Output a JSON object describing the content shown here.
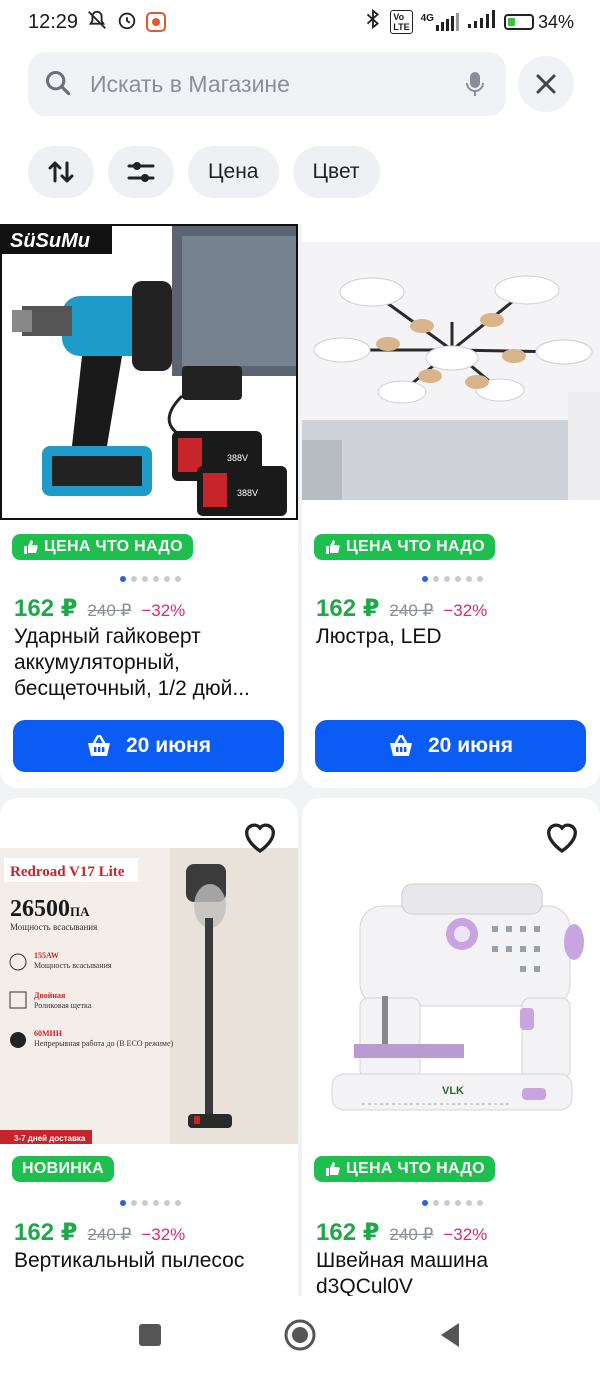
{
  "status": {
    "time": "12:29",
    "network": "4G",
    "battery": "34%",
    "battery_level_fraction": 0.34
  },
  "search": {
    "placeholder": "Искать в Магазине"
  },
  "filters": {
    "price_label": "Цена",
    "color_label": "Цвет"
  },
  "products": [
    {
      "badge": "ЦЕНА ЧТО НАДО",
      "price": "162 ₽",
      "old_price": "240 ₽",
      "discount": "−32%",
      "title": "Ударный гайковерт аккумуляторный, бесщеточный, 1/2 дюй...",
      "delivery": "20 июня",
      "image_brand": "SüSuMu",
      "battery_label": "388V"
    },
    {
      "badge": "ЦЕНА ЧТО НАДО",
      "price": "162 ₽",
      "old_price": "240 ₽",
      "discount": "−32%",
      "title": "Люстра, LED",
      "delivery": "20 июня"
    },
    {
      "badge": "НОВИНКА",
      "price": "162 ₽",
      "old_price": "240 ₽",
      "discount": "−32%",
      "title": "Вертикальный пылесос",
      "image_heading": "Redroad V17 Lite",
      "image_power": "26500",
      "image_power_unit": "ПА",
      "image_power_caption": "Мощность всасывания",
      "image_features": [
        {
          "title": "155AW",
          "text": "Мощность всасывания"
        },
        {
          "title": "Двойная",
          "text": "Роликовая щетка"
        },
        {
          "title": "60МИН",
          "text": "Непрерывная работа до (В ECO режиме)"
        }
      ],
      "image_delivery": "3-7 дней доставка"
    },
    {
      "badge": "ЦЕНА ЧТО НАДО",
      "price": "162 ₽",
      "old_price": "240 ₽",
      "discount": "−32%",
      "title": "Швейная машина d3QCul0V",
      "image_brand": "VLK"
    }
  ],
  "colors": {
    "accent": "#0a5cf5",
    "badge_green": "#1fbf4f",
    "price_green": "#1fa84a",
    "discount_pink": "#d62a7a"
  }
}
